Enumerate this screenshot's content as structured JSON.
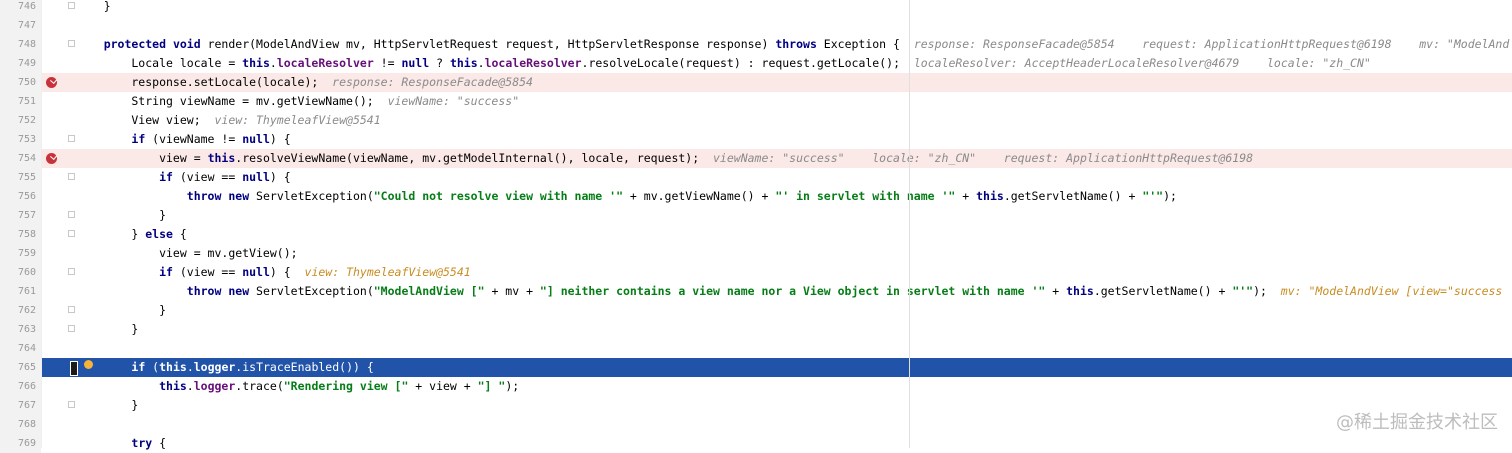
{
  "lines": [
    {
      "no": "746",
      "code": [
        {
          "t": "    }",
          "c": ""
        }
      ]
    },
    {
      "no": "747",
      "code": []
    },
    {
      "no": "748",
      "code": [
        {
          "t": "    ",
          "c": ""
        },
        {
          "t": "protected",
          "c": "kw"
        },
        {
          "t": " ",
          "c": ""
        },
        {
          "t": "void",
          "c": "kw"
        },
        {
          "t": " render(ModelAndView mv, HttpServletRequest request, HttpServletResponse response) ",
          "c": ""
        },
        {
          "t": "throws",
          "c": "kw"
        },
        {
          "t": " Exception {",
          "c": ""
        },
        {
          "t": "  response: ResponseFacade@5854    request: ApplicationHttpRequest@6198    mv: \"ModelAnd",
          "c": "hint"
        }
      ]
    },
    {
      "no": "749",
      "code": [
        {
          "t": "        Locale locale = ",
          "c": ""
        },
        {
          "t": "this",
          "c": "kw"
        },
        {
          "t": ".",
          "c": ""
        },
        {
          "t": "localeResolver",
          "c": "fld"
        },
        {
          "t": " != ",
          "c": ""
        },
        {
          "t": "null",
          "c": "kw"
        },
        {
          "t": " ? ",
          "c": ""
        },
        {
          "t": "this",
          "c": "kw"
        },
        {
          "t": ".",
          "c": ""
        },
        {
          "t": "localeResolver",
          "c": "fld"
        },
        {
          "t": ".resolveLocale(request) : request.getLocale();",
          "c": ""
        },
        {
          "t": "  localeResolver: AcceptHeaderLocaleResolver@4679    locale: \"zh_CN\"",
          "c": "hint"
        }
      ]
    },
    {
      "no": "750",
      "bp": true,
      "code": [
        {
          "t": "        response.setLocale(locale);",
          "c": ""
        },
        {
          "t": "  response: ResponseFacade@5854",
          "c": "hint"
        }
      ]
    },
    {
      "no": "751",
      "code": [
        {
          "t": "        String viewName = mv.getViewName();",
          "c": ""
        },
        {
          "t": "  viewName: \"success\"",
          "c": "hint"
        }
      ]
    },
    {
      "no": "752",
      "code": [
        {
          "t": "        View view;",
          "c": ""
        },
        {
          "t": "  view: ThymeleafView@5541",
          "c": "hint"
        }
      ]
    },
    {
      "no": "753",
      "code": [
        {
          "t": "        ",
          "c": ""
        },
        {
          "t": "if",
          "c": "kw"
        },
        {
          "t": " (viewName != ",
          "c": ""
        },
        {
          "t": "null",
          "c": "kw"
        },
        {
          "t": ") {",
          "c": ""
        }
      ]
    },
    {
      "no": "754",
      "bp": true,
      "code": [
        {
          "t": "            view = ",
          "c": ""
        },
        {
          "t": "this",
          "c": "kw"
        },
        {
          "t": ".resolveViewName(viewName, mv.getModelInternal(), locale, request);",
          "c": ""
        },
        {
          "t": "  viewName: \"success\"    locale: \"zh_CN\"    request: ApplicationHttpRequest@6198",
          "c": "hint"
        }
      ]
    },
    {
      "no": "755",
      "code": [
        {
          "t": "            ",
          "c": ""
        },
        {
          "t": "if",
          "c": "kw"
        },
        {
          "t": " (view == ",
          "c": ""
        },
        {
          "t": "null",
          "c": "kw"
        },
        {
          "t": ") {",
          "c": ""
        }
      ]
    },
    {
      "no": "756",
      "code": [
        {
          "t": "                ",
          "c": ""
        },
        {
          "t": "throw",
          "c": "kw"
        },
        {
          "t": " ",
          "c": ""
        },
        {
          "t": "new",
          "c": "kw"
        },
        {
          "t": " ServletException(",
          "c": ""
        },
        {
          "t": "\"Could not resolve view with name '\"",
          "c": "str"
        },
        {
          "t": " + mv.getViewName() + ",
          "c": ""
        },
        {
          "t": "\"' in servlet with name '\"",
          "c": "str"
        },
        {
          "t": " + ",
          "c": ""
        },
        {
          "t": "this",
          "c": "kw"
        },
        {
          "t": ".getServletName() + ",
          "c": ""
        },
        {
          "t": "\"'\"",
          "c": "str"
        },
        {
          "t": ");",
          "c": ""
        }
      ]
    },
    {
      "no": "757",
      "code": [
        {
          "t": "            }",
          "c": ""
        }
      ]
    },
    {
      "no": "758",
      "code": [
        {
          "t": "        } ",
          "c": ""
        },
        {
          "t": "else",
          "c": "kw"
        },
        {
          "t": " {",
          "c": ""
        }
      ]
    },
    {
      "no": "759",
      "code": [
        {
          "t": "            view = mv.getView();",
          "c": ""
        }
      ]
    },
    {
      "no": "760",
      "code": [
        {
          "t": "            ",
          "c": ""
        },
        {
          "t": "if",
          "c": "kw"
        },
        {
          "t": " (view == ",
          "c": ""
        },
        {
          "t": "null",
          "c": "kw"
        },
        {
          "t": ") {",
          "c": ""
        },
        {
          "t": "  view: ThymeleafView@5541",
          "c": "hint orange"
        }
      ]
    },
    {
      "no": "761",
      "code": [
        {
          "t": "                ",
          "c": ""
        },
        {
          "t": "throw",
          "c": "kw"
        },
        {
          "t": " ",
          "c": ""
        },
        {
          "t": "new",
          "c": "kw"
        },
        {
          "t": " ServletException(",
          "c": ""
        },
        {
          "t": "\"ModelAndView [\"",
          "c": "str"
        },
        {
          "t": " + mv + ",
          "c": ""
        },
        {
          "t": "\"] neither contains a view name nor a View object in servlet with name '\"",
          "c": "str"
        },
        {
          "t": " + ",
          "c": ""
        },
        {
          "t": "this",
          "c": "kw"
        },
        {
          "t": ".getServletName() + ",
          "c": ""
        },
        {
          "t": "\"'\"",
          "c": "str"
        },
        {
          "t": ");",
          "c": ""
        },
        {
          "t": "  mv: \"ModelAndView [view=\"success",
          "c": "hint orange"
        }
      ]
    },
    {
      "no": "762",
      "code": [
        {
          "t": "            }",
          "c": ""
        }
      ]
    },
    {
      "no": "763",
      "code": [
        {
          "t": "        }",
          "c": ""
        }
      ]
    },
    {
      "no": "764",
      "code": []
    },
    {
      "no": "765",
      "cur": true,
      "code": [
        {
          "t": "        ",
          "c": ""
        },
        {
          "t": "if",
          "c": "kw"
        },
        {
          "t": " (",
          "c": ""
        },
        {
          "t": "this",
          "c": "kw"
        },
        {
          "t": ".",
          "c": ""
        },
        {
          "t": "logger",
          "c": "fld"
        },
        {
          "t": ".isTraceEnabled()) {",
          "c": ""
        }
      ]
    },
    {
      "no": "766",
      "code": [
        {
          "t": "            ",
          "c": ""
        },
        {
          "t": "this",
          "c": "kw"
        },
        {
          "t": ".",
          "c": ""
        },
        {
          "t": "logger",
          "c": "fld"
        },
        {
          "t": ".trace(",
          "c": ""
        },
        {
          "t": "\"Rendering view [\"",
          "c": "str"
        },
        {
          "t": " + view + ",
          "c": ""
        },
        {
          "t": "\"] \"",
          "c": "str"
        },
        {
          "t": ");",
          "c": ""
        }
      ]
    },
    {
      "no": "767",
      "code": [
        {
          "t": "        }",
          "c": ""
        }
      ]
    },
    {
      "no": "768",
      "code": []
    },
    {
      "no": "769",
      "code": [
        {
          "t": "        ",
          "c": ""
        },
        {
          "t": "try",
          "c": "kw"
        },
        {
          "t": " {",
          "c": ""
        }
      ]
    }
  ],
  "fold_lines": [
    "746",
    "748",
    "753",
    "755",
    "757",
    "758",
    "760",
    "762",
    "763",
    "767"
  ],
  "watermark": "@稀土掘金技术社区",
  "colors": {
    "breakpoint_line": "#fae9e7",
    "current_line": "#2154a8",
    "keyword": "#000080",
    "string": "#067d17",
    "field": "#660e7a",
    "hint": "#8a8a8a"
  }
}
